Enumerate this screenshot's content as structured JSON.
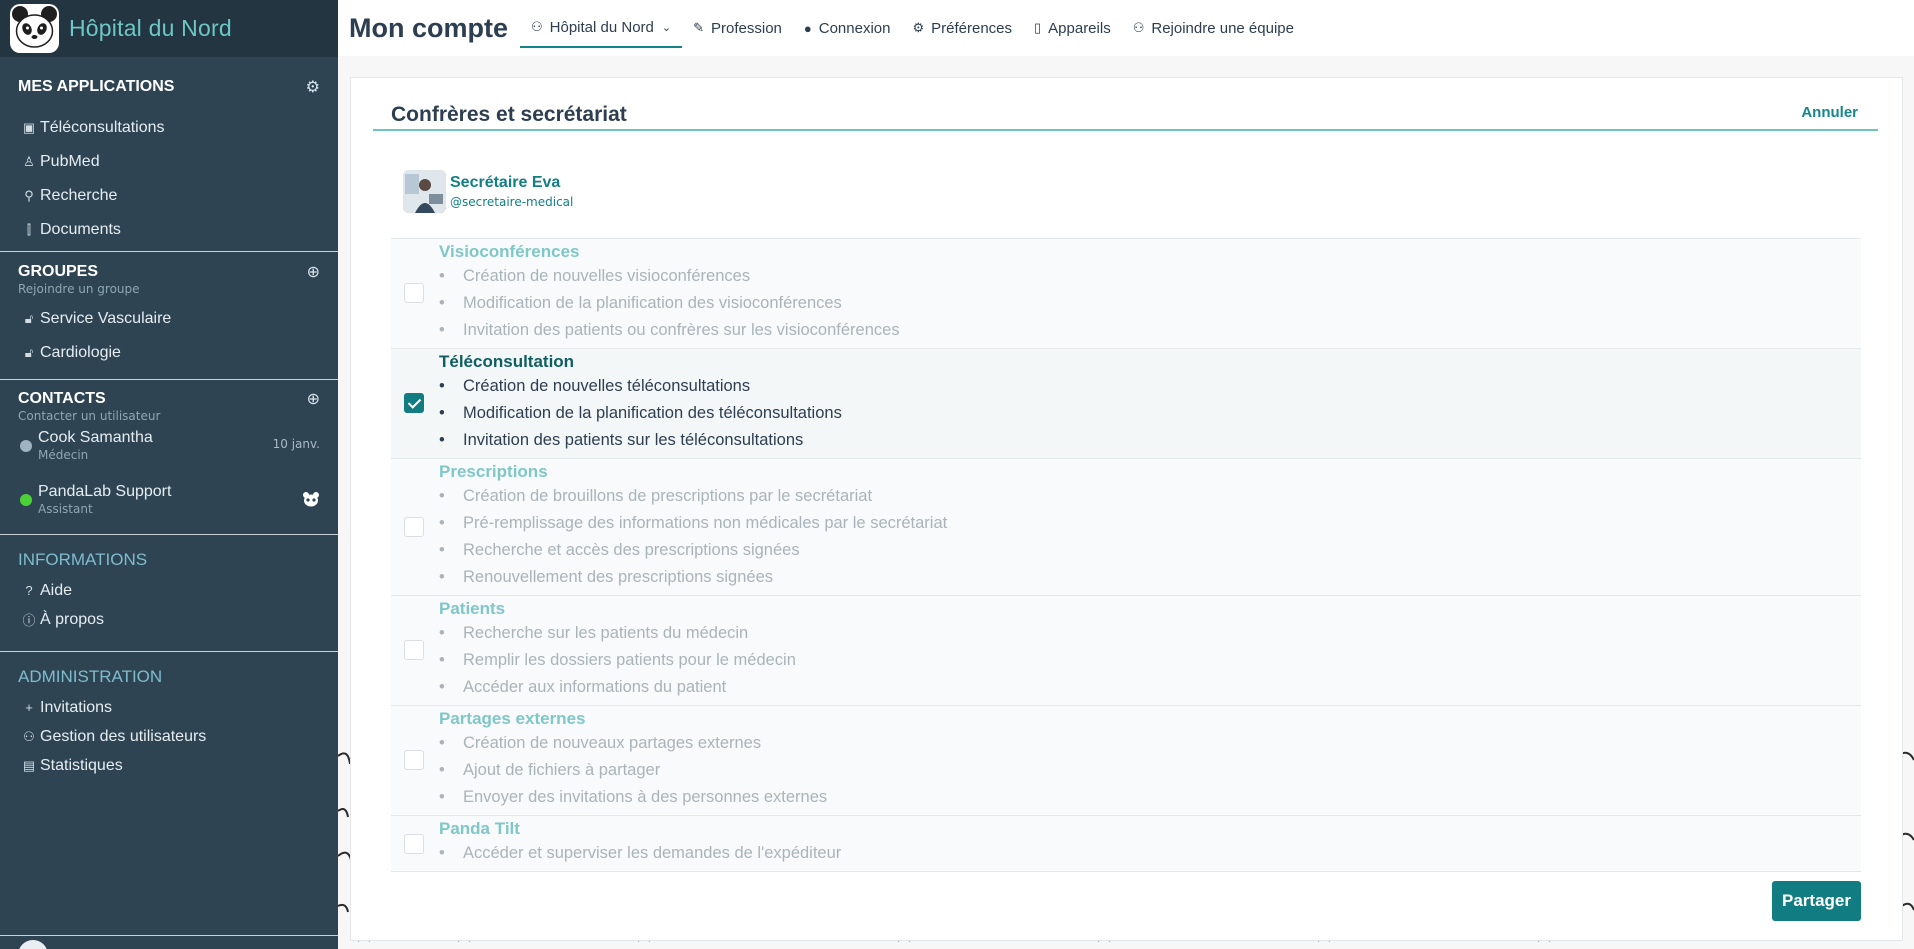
{
  "brand": {
    "title": "Hôpital du Nord"
  },
  "sidebar": {
    "apps": {
      "title": "MES APPLICATIONS",
      "items": [
        {
          "label": "Téléconsultations",
          "icon": "teleconsult-icon"
        },
        {
          "label": "PubMed",
          "icon": "pubmed-icon"
        },
        {
          "label": "Recherche",
          "icon": "search-icon"
        },
        {
          "label": "Documents",
          "icon": "paperclip-icon"
        }
      ]
    },
    "groups": {
      "title": "GROUPES",
      "subtitle": "Rejoindre un groupe",
      "items": [
        {
          "label": "Service Vasculaire",
          "icon": "lock-icon"
        },
        {
          "label": "Cardiologie",
          "icon": "lock-icon"
        }
      ]
    },
    "contacts": {
      "title": "CONTACTS",
      "subtitle": "Contacter un utilisateur",
      "items": [
        {
          "name": "Cook Samantha",
          "role": "Médecin",
          "date": "10 janv.",
          "status_color": "#9fb4c0"
        },
        {
          "name": "PandaLab Support",
          "role": "Assistant",
          "status_color": "#4cd137"
        }
      ]
    },
    "informations": {
      "title": "INFORMATIONS",
      "items": [
        {
          "label": "Aide",
          "icon": "question-icon"
        },
        {
          "label": "À propos",
          "icon": "info-icon"
        }
      ]
    },
    "administration": {
      "title": "ADMINISTRATION",
      "items": [
        {
          "label": "Invitations",
          "icon": "plus-icon"
        },
        {
          "label": "Gestion des utilisateurs",
          "icon": "users-icon"
        },
        {
          "label": "Statistiques",
          "icon": "chart-file-icon"
        }
      ]
    }
  },
  "header": {
    "title": "Mon compte",
    "tabs": [
      {
        "label": "Hôpital du Nord",
        "icon": "users-icon",
        "active": true
      },
      {
        "label": "Profession",
        "icon": "pen-icon"
      },
      {
        "label": "Connexion",
        "icon": "user-icon"
      },
      {
        "label": "Préférences",
        "icon": "gear-icon"
      },
      {
        "label": "Appareils",
        "icon": "phone-icon"
      },
      {
        "label": "Rejoindre une équipe",
        "icon": "users-plus-icon"
      }
    ]
  },
  "card": {
    "title": "Confrères et secrétariat",
    "cancel_label": "Annuler",
    "user": {
      "name": "Secrétaire Eva",
      "handle": "@secretaire-medical"
    },
    "permissions": [
      {
        "title": "Visioconférences",
        "checked": false,
        "items": [
          "Création de nouvelles visioconférences",
          "Modification de la planification des visioconférences",
          "Invitation des patients ou confrères sur les visioconférences"
        ]
      },
      {
        "title": "Téléconsultation",
        "checked": true,
        "items": [
          "Création de nouvelles téléconsultations",
          "Modification de la planification des téléconsultations",
          "Invitation des patients sur les téléconsultations"
        ]
      },
      {
        "title": "Prescriptions",
        "checked": false,
        "items": [
          "Création de brouillons de prescriptions par le secrétariat",
          "Pré-remplissage des informations non médicales par le secrétariat",
          "Recherche et accès des prescriptions signées",
          "Renouvellement des prescriptions signées"
        ]
      },
      {
        "title": "Patients",
        "checked": false,
        "items": [
          "Recherche sur les patients du médecin",
          "Remplir les dossiers patients pour le médecin",
          "Accéder aux informations du patient"
        ]
      },
      {
        "title": "Partages externes",
        "checked": false,
        "items": [
          "Création de nouveaux partages externes",
          "Ajout de fichiers à partager",
          "Envoyer des invitations à des personnes externes"
        ]
      },
      {
        "title": "Panda Tilt",
        "checked": false,
        "items": [
          "Accéder et superviser les demandes de l'expéditeur"
        ]
      }
    ],
    "share_label": "Partager"
  },
  "colors": {
    "accent": "#127c83",
    "sidebar_bg": "#2e4453",
    "brand_text": "#6cc7c6"
  }
}
